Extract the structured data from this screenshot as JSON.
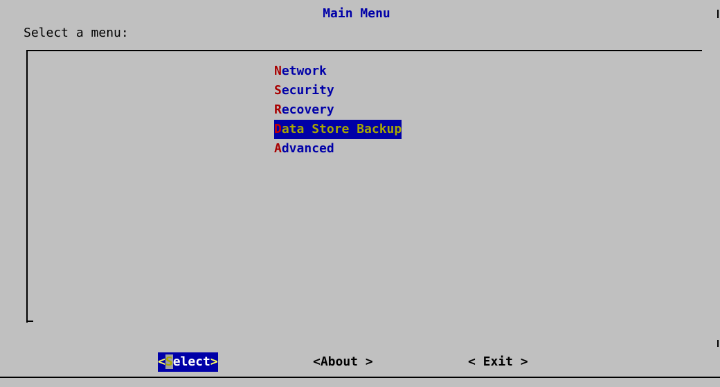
{
  "dialog": {
    "title": "Main Menu",
    "prompt": "Select a menu:"
  },
  "menu": {
    "items": [
      {
        "hotkey": "N",
        "rest": "etwork",
        "selected": false
      },
      {
        "hotkey": "S",
        "rest": "ecurity",
        "selected": false
      },
      {
        "hotkey": "R",
        "rest": "ecovery",
        "selected": false
      },
      {
        "hotkey": "D",
        "rest": "ata Store Backup",
        "selected": true
      },
      {
        "hotkey": "A",
        "rest": "dvanced",
        "selected": false
      }
    ]
  },
  "buttons": {
    "select": {
      "open": "<",
      "cursor": "S",
      "rest": "elect",
      "close": ">"
    },
    "about": "<About >",
    "exit": "< Exit >"
  },
  "colors": {
    "background": "#c0c0c0",
    "title": "#0000a8",
    "menu_text": "#0000a8",
    "hotkey": "#a80000",
    "selection_bg": "#0000a8",
    "selection_fg": "#a8a800"
  }
}
